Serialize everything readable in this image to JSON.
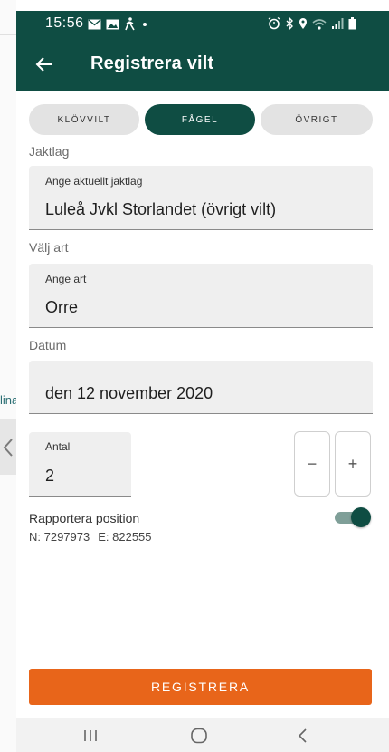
{
  "background": {
    "left_text": "lina"
  },
  "status_bar": {
    "time": "15:56",
    "icons_left": [
      "mail-icon",
      "image-icon",
      "walking-icon",
      "dot-icon"
    ],
    "icons_right": [
      "alarm-icon",
      "bluetooth-icon",
      "location-icon",
      "wifi-icon",
      "signal-icon",
      "battery-icon"
    ]
  },
  "app_bar": {
    "title": "Registrera vilt",
    "back_icon": "arrow-left-icon"
  },
  "category_tabs": [
    {
      "label": "KLÖVVILT",
      "selected": false
    },
    {
      "label": "FÅGEL",
      "selected": true
    },
    {
      "label": "ÖVRIGT",
      "selected": false
    }
  ],
  "form": {
    "jaktlag_section": "Jaktlag",
    "jaktlag_label": "Ange aktuellt jaktlag",
    "jaktlag_value": "Luleå Jvkl Storlandet (övrigt vilt)",
    "art_section": "Välj art",
    "art_label": "Ange art",
    "art_value": "Orre",
    "datum_section": "Datum",
    "datum_value": "den 12 november 2020",
    "antal_label": "Antal",
    "antal_value": "2",
    "minus_label": "−",
    "plus_label": "+",
    "position_label": "Rapportera position",
    "position_enabled": true,
    "coord_n": "N: 7297973",
    "coord_e": "E: 822555",
    "submit_label": "REGISTRERA"
  },
  "colors": {
    "primary": "#0f4d43",
    "accent": "#e8651a"
  },
  "nav_bar": {
    "items": [
      "recent-apps-icon",
      "home-icon",
      "back-icon"
    ]
  }
}
